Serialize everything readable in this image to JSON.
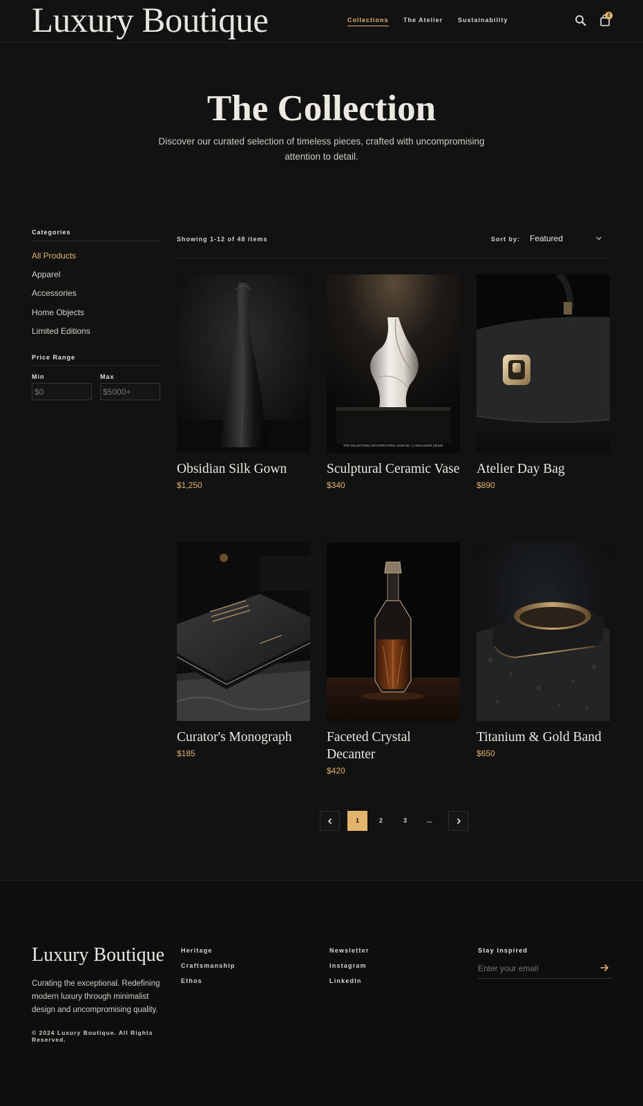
{
  "brand": "Luxury Boutique",
  "nav": [
    "Collections",
    "The Atelier",
    "Sustainability"
  ],
  "cart_count": "2",
  "hero": {
    "title": "The Collection",
    "subtitle": "Discover our curated selection of timeless pieces, crafted with uncompromising attention to detail."
  },
  "sidebar": {
    "categories_title": "Categories",
    "categories": [
      "All Products",
      "Apparel",
      "Accessories",
      "Home Objects",
      "Limited Editions"
    ],
    "price_title": "Price Range",
    "min_label": "Min",
    "max_label": "Max",
    "min_placeholder": "$0",
    "max_placeholder": "$5000+"
  },
  "toolbar": {
    "showing": "Showing 1-12 of 48 items",
    "sort_label": "Sort by:",
    "sort_value": "Featured"
  },
  "products": [
    {
      "name": "Obsidian Silk Gown",
      "price": "$1,250"
    },
    {
      "name": "Sculptural Ceramic Vase",
      "price": "$340"
    },
    {
      "name": "Atelier Day Bag",
      "price": "$890"
    },
    {
      "name": "Curator's Monograph",
      "price": "$185"
    },
    {
      "name": "Faceted Crystal Decanter",
      "price": "$420"
    },
    {
      "name": "Titanium & Gold Band",
      "price": "$650"
    }
  ],
  "vase_caption": "THE COLLECTION  |  ARCHITECTURAL VASE NO. 1  |  EXCLUSIVE  |  $1450",
  "pagination": {
    "pages": [
      "1",
      "2",
      "3",
      "..."
    ]
  },
  "footer": {
    "brand": "Luxury Boutique",
    "description": "Curating the exceptional. Redefining modern luxury through minimalist design and uncompromising quality.",
    "copyright": "© 2024 Luxury Boutique. All Rights Reserved.",
    "links_col1": [
      "Heritage",
      "Craftsmanship",
      "Ethos"
    ],
    "links_col2": [
      "Newsletter",
      "Instagram",
      "LinkedIn"
    ],
    "newsletter_title": "Stay Inspired",
    "email_placeholder": "Enter your email"
  },
  "colors": {
    "background": "#121212",
    "accent": "#e3b46b",
    "text": "#e8e5e0"
  },
  "icons": [
    "search-icon",
    "shopping-bag-icon",
    "chevron-down-icon",
    "chevron-left-icon",
    "chevron-right-icon",
    "arrow-right-icon"
  ]
}
